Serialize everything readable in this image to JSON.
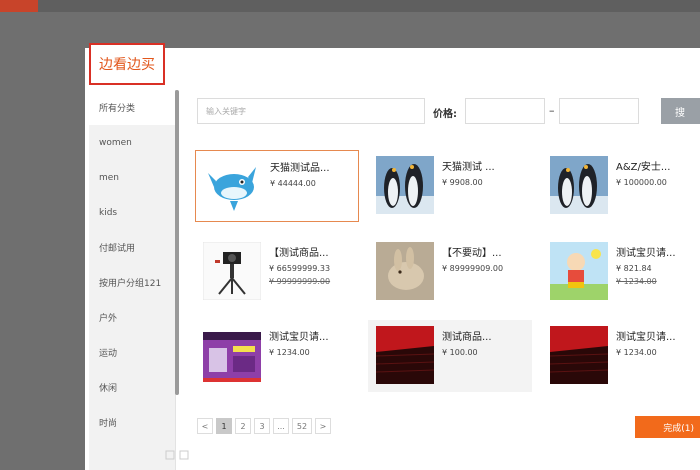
{
  "modal": {
    "title": "边看边买"
  },
  "sidebar": {
    "items": [
      {
        "label": "所有分类"
      },
      {
        "label": "women"
      },
      {
        "label": "men"
      },
      {
        "label": "kids"
      },
      {
        "label": "付邮试用"
      },
      {
        "label": "按用户分组121"
      },
      {
        "label": "户外"
      },
      {
        "label": "运动"
      },
      {
        "label": "休闲"
      },
      {
        "label": "时尚"
      }
    ]
  },
  "search": {
    "placeholder": "输入关键字",
    "price_label": "价格:",
    "dash": "–",
    "button_label": "搜"
  },
  "products": [
    {
      "title": "天猫测试品...",
      "price": "¥ 44444.00",
      "orig": "",
      "thumb": "dolphin-cartoon"
    },
    {
      "title": "天猫测试 ...",
      "price": "¥ 9908.00",
      "orig": "",
      "thumb": "penguins"
    },
    {
      "title": "A&Z/安士...",
      "price": "¥ 100000.00",
      "orig": "",
      "thumb": "penguins"
    },
    {
      "title": "【测试商品...",
      "price": "¥ 66599999.33",
      "orig": "¥ 99999999.00",
      "thumb": "tripod-camera"
    },
    {
      "title": "【不要动】...",
      "price": "¥ 89999909.00",
      "orig": "",
      "thumb": "bunny"
    },
    {
      "title": "测试宝贝请...",
      "price": "¥ 821.84",
      "orig": "¥ 1234.00",
      "thumb": "cartoon-boy"
    },
    {
      "title": "测试宝贝请...",
      "price": "¥ 1234.00",
      "orig": "",
      "thumb": "purple-banner"
    },
    {
      "title": "测试商品...",
      "price": "¥ 100.00",
      "orig": "",
      "thumb": "red-stage"
    },
    {
      "title": "测试宝贝请...",
      "price": "¥ 1234.00",
      "orig": "",
      "thumb": "red-stage"
    }
  ],
  "pagination": {
    "prev": "<",
    "pages": [
      "1",
      "2",
      "3",
      "...",
      "52"
    ],
    "next": ">",
    "current": "1"
  },
  "footer": {
    "done_label": "完成(1)"
  },
  "colors": {
    "accent": "#f26a1b",
    "title_border": "#d93025",
    "title_text": "#e2561b"
  }
}
